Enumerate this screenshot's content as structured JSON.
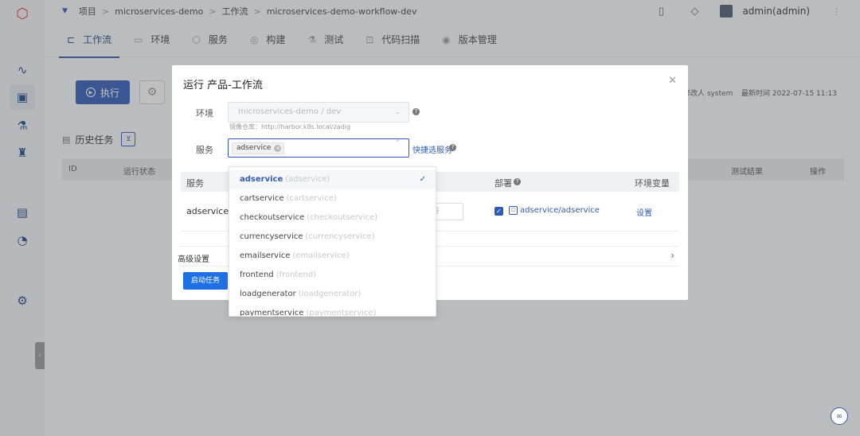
{
  "topbar": {
    "breadcrumb": [
      "项目",
      "microservices-demo",
      "工作流",
      "microservices-demo-workflow-dev"
    ],
    "separator": ">",
    "user": "admin(admin)"
  },
  "tabs": [
    {
      "label": "工作流",
      "active": true
    },
    {
      "label": "环境"
    },
    {
      "label": "服务"
    },
    {
      "label": "构建"
    },
    {
      "label": "测试"
    },
    {
      "label": "代码扫描"
    },
    {
      "label": "版本管理"
    }
  ],
  "page": {
    "execute_label": "执行",
    "modifier": "修改人 system",
    "modified_time": "最新时间 2022-07-15 11:13",
    "history_label": "历史任务",
    "table_headers": {
      "id": "ID",
      "status": "运行状态",
      "test_result": "测试结果",
      "actions": "操作"
    }
  },
  "modal": {
    "title": "运行 产品-工作流",
    "env_label": "环境",
    "env_value": "microservices-demo / dev",
    "registry": "镜像仓库：http://harbor.k8s.local/zadig",
    "service_label": "服务",
    "selected_tag": "adservice",
    "quick_select": "快捷选服务",
    "table_headers": {
      "service": "服务",
      "deploy": "部署",
      "env_vars": "环境变量"
    },
    "row": {
      "service": "adservice",
      "number_placeholder": "号",
      "deploy": "adservice/adservice",
      "setting": "设置"
    },
    "advanced": "高级设置",
    "start": "启动任务"
  },
  "dropdown": {
    "options": [
      {
        "name": "adservice",
        "alias": "(adservice)",
        "selected": true
      },
      {
        "name": "cartservice",
        "alias": "(cartservice)"
      },
      {
        "name": "checkoutservice",
        "alias": "(checkoutservice)"
      },
      {
        "name": "currencyservice",
        "alias": "(currencyservice)"
      },
      {
        "name": "emailservice",
        "alias": "(emailservice)"
      },
      {
        "name": "frontend",
        "alias": "(frontend)"
      },
      {
        "name": "loadgenerator",
        "alias": "(loadgenerator)"
      },
      {
        "name": "paymentservice",
        "alias": "(paymentservice)"
      }
    ]
  },
  "colors": {
    "primary": "#2f5bb7",
    "button": "#1f6fe5",
    "logo": "#e53935"
  }
}
